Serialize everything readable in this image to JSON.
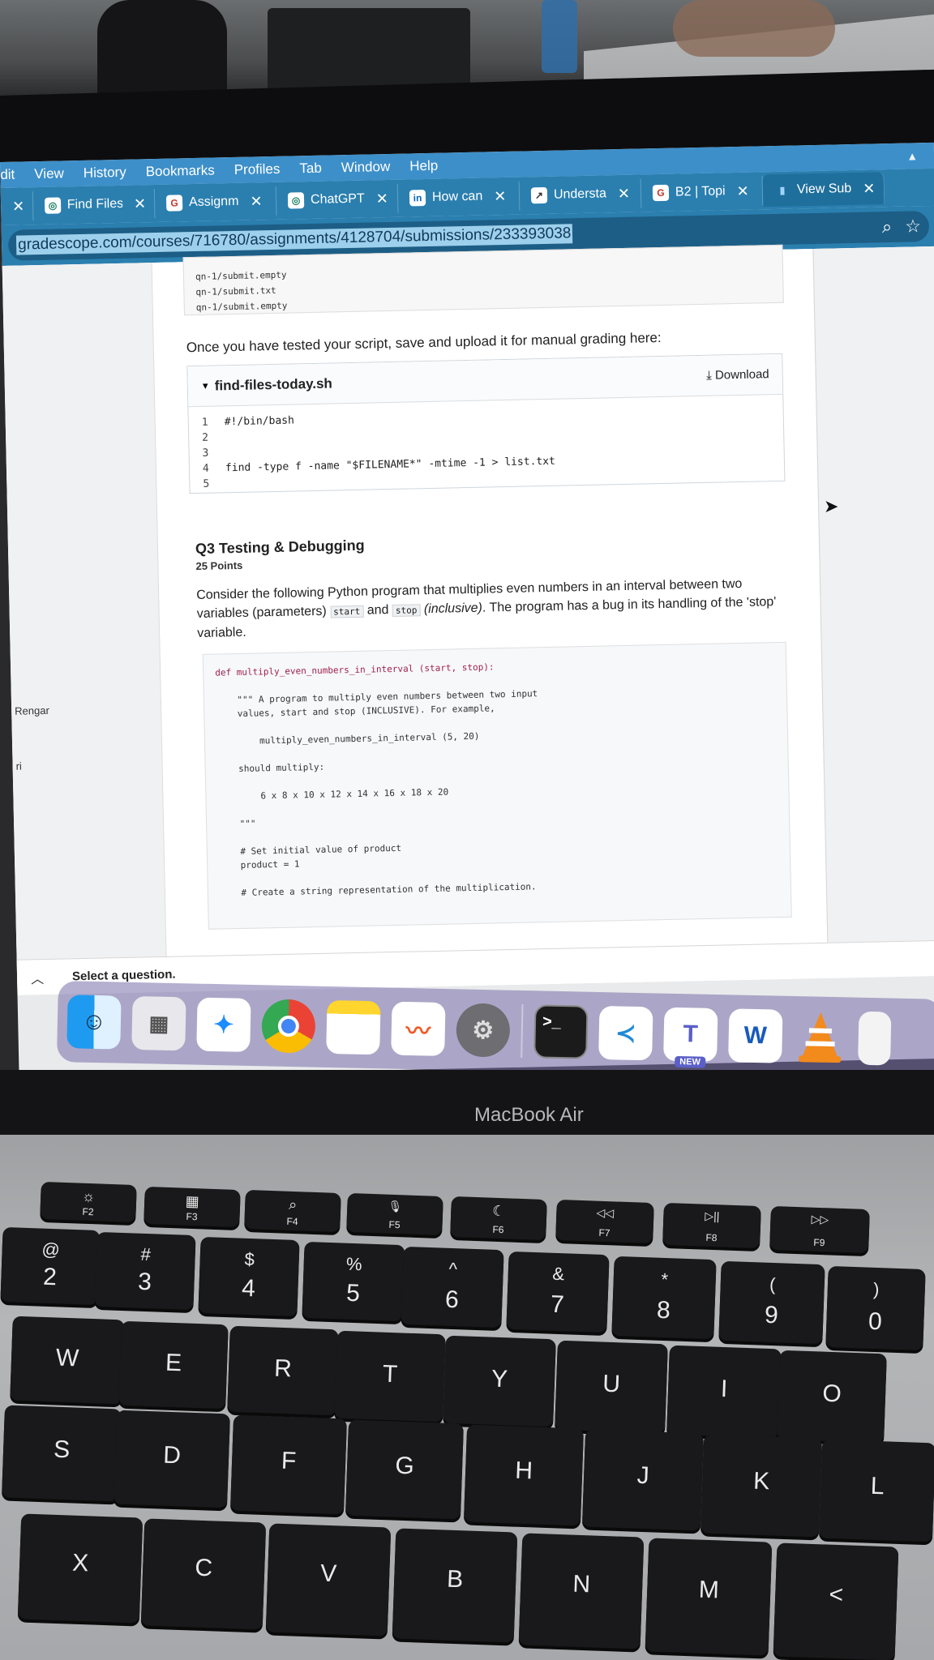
{
  "menubar": {
    "items": [
      "dit",
      "View",
      "History",
      "Bookmarks",
      "Profiles",
      "Tab",
      "Window",
      "Help"
    ]
  },
  "tabs": [
    {
      "label": "",
      "close": "✕",
      "icon": "none"
    },
    {
      "label": "Find Files",
      "close": "✕",
      "icon": "chatgpt-icon"
    },
    {
      "label": "Assignm",
      "close": "✕",
      "icon": "gradescope-icon"
    },
    {
      "label": "ChatGPT",
      "close": "✕",
      "icon": "chatgpt-icon"
    },
    {
      "label": "How can",
      "close": "✕",
      "icon": "linkedin-icon"
    },
    {
      "label": "Understa",
      "close": "✕",
      "icon": "chart-icon"
    },
    {
      "label": "B2 | Topi",
      "close": "✕",
      "icon": "gradescope-icon"
    },
    {
      "label": "View Sub",
      "close": "✕",
      "icon": "bar-chart-icon"
    }
  ],
  "url": "gradescope.com/courses/716780/assignments/4128704/submissions/233393038",
  "sidebar": {
    "label_1": "Rengar",
    "label_2": "ri"
  },
  "prev_output": [
    "qn-1/submit.empty",
    "qn-1/submit.txt",
    "qn-1/submit.empty"
  ],
  "instructions": "Once you have tested your script, save and upload it for manual grading here:",
  "file": {
    "name": "find-files-today.sh",
    "download_label": "Download",
    "lines": [
      {
        "n": "1",
        "code": "#!/bin/bash"
      },
      {
        "n": "2",
        "code": ""
      },
      {
        "n": "3",
        "code": ""
      },
      {
        "n": "4",
        "code": "find -type f -name \"$FILENAME*\" -mtime -1 > list.txt"
      },
      {
        "n": "5",
        "code": ""
      }
    ]
  },
  "q3": {
    "title": "Q3 Testing & Debugging",
    "points": "25 Points",
    "desc_1": "Consider the following Python program that multiplies even numbers in an interval between two variables (parameters)",
    "code_start": "start",
    "and": "and",
    "code_stop": "stop",
    "inclusive": "(inclusive)",
    "desc_2": ". The program has a bug in its handling of the 'stop' variable."
  },
  "python_code": [
    "def multiply_even_numbers_in_interval (start, stop):",
    "",
    "    \"\"\" A program to multiply even numbers between two input",
    "    values, start and stop (INCLUSIVE). For example,",
    "",
    "        multiply_even_numbers_in_interval (5, 20)",
    "",
    "    should multiply:",
    "",
    "        6 x 8 x 10 x 12 x 14 x 16 x 18 x 20",
    "",
    "    \"\"\"",
    "",
    "    # Set initial value of product",
    "    product = 1",
    "",
    "    # Create a string representation of the multiplication."
  ],
  "select_question": "Select a question.",
  "dock": {
    "apps": [
      "finder",
      "launchpad",
      "safari",
      "chrome",
      "notes",
      "freeform",
      "system-settings",
      "terminal",
      "vscode",
      "teams",
      "word",
      "vlc"
    ],
    "teams_badge": "NEW",
    "terminal_glyph": ">_",
    "word_glyph": "W",
    "teams_glyph": "T"
  },
  "laptop_brand": "MacBook Air",
  "keyboard": {
    "fn_keys": [
      {
        "icon": "☼",
        "label": "F2"
      },
      {
        "icon": "▦",
        "label": "F3"
      },
      {
        "icon": "⌕",
        "label": "F4"
      },
      {
        "icon": "🎙",
        "label": "F5"
      },
      {
        "icon": "☾",
        "label": "F6"
      },
      {
        "icon": "◁◁",
        "label": "F7"
      },
      {
        "icon": "▷||",
        "label": "F8"
      },
      {
        "icon": "▷▷",
        "label": "F9"
      }
    ],
    "number_keys": [
      {
        "sym": "@",
        "num": "2"
      },
      {
        "sym": "#",
        "num": "3"
      },
      {
        "sym": "$",
        "num": "4"
      },
      {
        "sym": "%",
        "num": "5"
      },
      {
        "sym": "^",
        "num": "6"
      },
      {
        "sym": "&",
        "num": "7"
      },
      {
        "sym": "*",
        "num": "8"
      },
      {
        "sym": "(",
        "num": "9"
      },
      {
        "sym": ")",
        "num": "0"
      }
    ],
    "row_qwerty": [
      "W",
      "E",
      "R",
      "T",
      "Y",
      "U",
      "I",
      "O"
    ],
    "row_home": [
      "S",
      "D",
      "F",
      "G",
      "H",
      "J",
      "K",
      "L"
    ],
    "row_bottom": [
      "X",
      "C",
      "V",
      "B",
      "N",
      "M",
      "<"
    ]
  }
}
